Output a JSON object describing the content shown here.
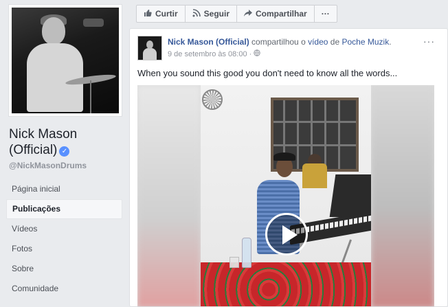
{
  "page": {
    "name_line1": "Nick Mason",
    "name_line2": "(Official)",
    "handle": "@NickMasonDrums"
  },
  "nav": {
    "items": [
      {
        "label": "Página inicial",
        "active": false
      },
      {
        "label": "Publicações",
        "active": true
      },
      {
        "label": "Vídeos",
        "active": false
      },
      {
        "label": "Fotos",
        "active": false
      },
      {
        "label": "Sobre",
        "active": false
      },
      {
        "label": "Comunidade",
        "active": false
      }
    ]
  },
  "actions": {
    "like": {
      "label": "Curtir",
      "icon": "thumbs-up-icon"
    },
    "follow": {
      "label": "Seguir",
      "icon": "rss-icon"
    },
    "share": {
      "label": "Compartilhar",
      "icon": "share-arrow-icon"
    },
    "more": {
      "label": "···",
      "icon": "more-icon"
    }
  },
  "post": {
    "author": "Nick Mason (Official)",
    "verb": "compartilhou o",
    "object": "vídeo",
    "preposition": "de",
    "source": "Poche Muzik",
    "source_suffix": ".",
    "date": "9 de setembro às 08:00",
    "privacy_icon": "globe-icon",
    "more": "···",
    "text": "When you sound this good you don't need to know all the words..."
  },
  "colors": {
    "link": "#365899",
    "verified": "#5890ff",
    "background": "#e9ebee"
  }
}
